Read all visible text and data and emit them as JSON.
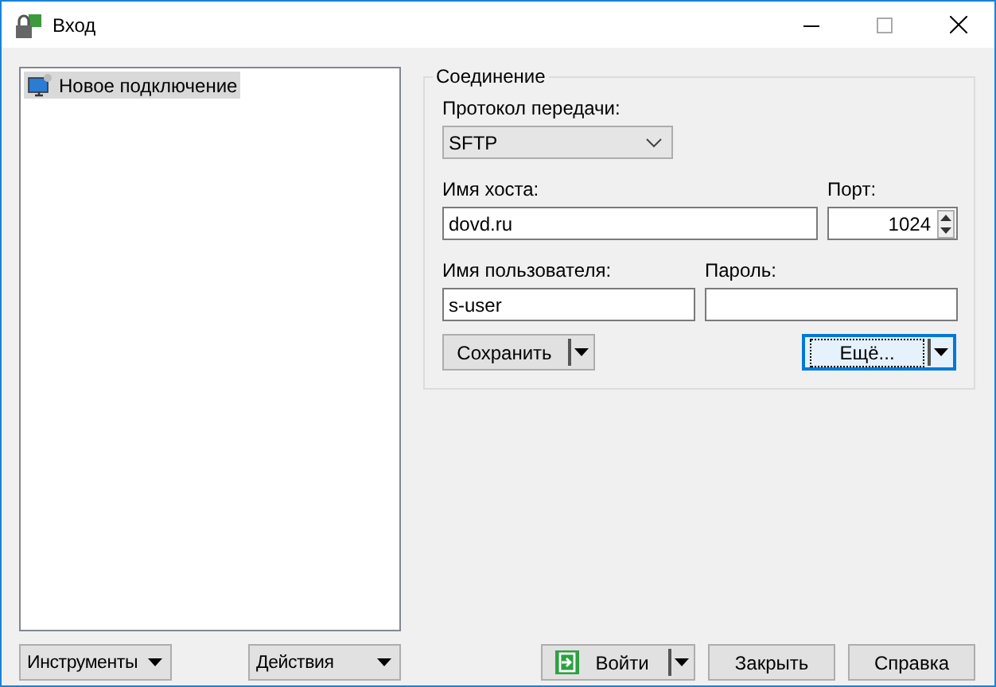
{
  "window": {
    "title": "Вход"
  },
  "sites": [
    {
      "label": "Новое подключение",
      "selected": true
    }
  ],
  "connection": {
    "title": "Соединение",
    "protocol_label": "Протокол передачи:",
    "protocol": "SFTP",
    "host_label": "Имя хоста:",
    "host": "dovd.ru",
    "port_label": "Порт:",
    "port": "1024",
    "user_label": "Имя пользователя:",
    "user": "s-user",
    "password_label": "Пароль:",
    "save_button": "Сохранить",
    "more_button": "Ещё..."
  },
  "footer": {
    "tools_button": "Инструменты",
    "actions_button": "Действия",
    "login_button": "Войти",
    "close_button": "Закрыть",
    "help_button": "Справка"
  }
}
